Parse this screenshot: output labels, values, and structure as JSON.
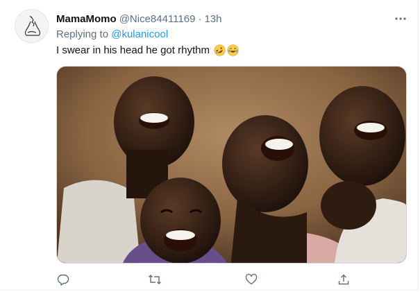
{
  "tweet": {
    "display_name": "MamaMomo",
    "handle": "@Nice84411169",
    "separator": "·",
    "time": "13h",
    "replying_prefix": "Replying to",
    "replying_to": "@kulanicool",
    "text": "I swear in his head he got rhythm",
    "emojis": [
      "rolling-on-floor-laughing-emoji",
      "tears-of-joy-emoji"
    ]
  },
  "colors": {
    "text_primary": "#0f1419",
    "text_secondary": "#5b7083",
    "link": "#1d9bf0",
    "border": "#cfd9de"
  },
  "media": {
    "description_icon": "photo-of-laughing-children"
  },
  "actions": [
    {
      "icon": "reply-icon"
    },
    {
      "icon": "retweet-icon"
    },
    {
      "icon": "like-icon"
    },
    {
      "icon": "share-icon"
    }
  ]
}
